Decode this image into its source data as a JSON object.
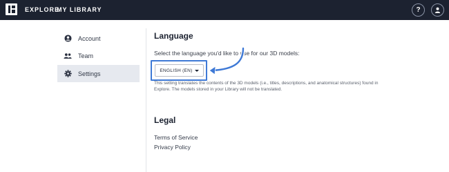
{
  "topbar": {
    "explore": "EXPLORE",
    "library": "MY LIBRARY",
    "help": "?"
  },
  "sidebar": {
    "items": [
      {
        "label": "Account",
        "icon": "account-icon"
      },
      {
        "label": "Team",
        "icon": "team-icon"
      },
      {
        "label": "Settings",
        "icon": "gear-icon",
        "active": true
      }
    ]
  },
  "language": {
    "heading": "Language",
    "prompt": "Select the language you'd like to use for our 3D models:",
    "selected": "ENGLISH (EN)",
    "note": "This setting translates the contents of the 3D models (i.e., titles, descriptions, and anatomical structures) found in Explore. The models stored in your Library will not be translated."
  },
  "legal": {
    "heading": "Legal",
    "links": [
      "Terms of Service",
      "Privacy Policy"
    ]
  },
  "colors": {
    "topbar": "#1c2230",
    "highlight": "#3e79d6",
    "active_bg": "#e6e9ef"
  }
}
